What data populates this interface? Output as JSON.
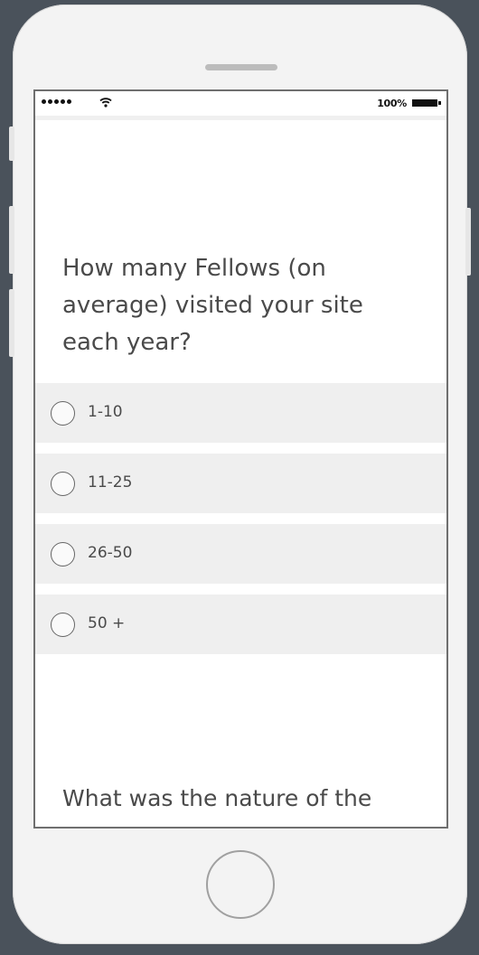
{
  "status_bar": {
    "battery_percent": "100%"
  },
  "question1": {
    "text": "How many Fellows (on average) visited your site each year?",
    "options": [
      {
        "label": "1-10",
        "selected": false
      },
      {
        "label": "11-25",
        "selected": false
      },
      {
        "label": "26-50",
        "selected": false
      },
      {
        "label": "50 +",
        "selected": false
      }
    ]
  },
  "question2": {
    "text": "What was the nature of the"
  },
  "colors": {
    "background": "#4a525b",
    "phone_body": "#f3f3f3",
    "option_background": "#efefef",
    "text": "#4a4a4a"
  }
}
